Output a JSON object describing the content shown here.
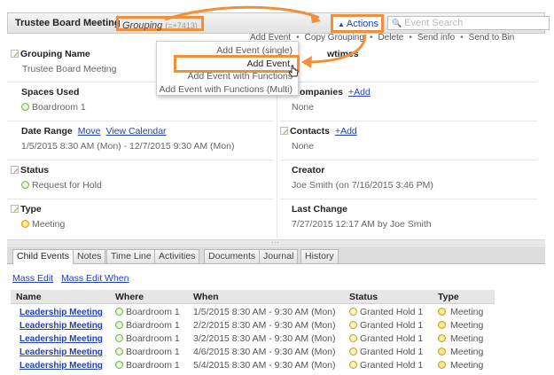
{
  "header": {
    "title": "Trustee Board Meeting",
    "grouping_label": "Grouping",
    "grouping_id": "(=+7413)",
    "actions_label": "Actions",
    "search_placeholder": "Event Search"
  },
  "action_links": [
    "Add Event",
    "Copy Grouping",
    "Delete",
    "Send info",
    "Send to Bin"
  ],
  "dropdown": {
    "items": [
      "Add Event (single)",
      "Add Event",
      "Add Event with Functions",
      "Add Event with Functions (Multi)"
    ]
  },
  "fields": {
    "grouping_name": {
      "label": "Grouping Name",
      "value": "Trustee Board Meeting"
    },
    "showtimes": {
      "label": "wtimes"
    },
    "spaces_used": {
      "label": "Spaces Used",
      "value": "Boardroom 1"
    },
    "companies": {
      "label": "ompanies",
      "add": "+Add",
      "value": "None"
    },
    "date_range": {
      "label": "Date Range",
      "move": "Move",
      "view_calendar": "View Calendar",
      "value": "1/5/2015 8:30 AM (Mon) - 12/7/2015 9:30 AM (Mon)"
    },
    "contacts": {
      "label": "Contacts",
      "add": "+Add",
      "value": "None"
    },
    "status": {
      "label": "Status",
      "value": "Request for Hold"
    },
    "creator": {
      "label": "Creator",
      "value": "Joe Smith (on 7/16/2015 3:46 PM)"
    },
    "type": {
      "label": "Type",
      "value": "Meeting"
    },
    "last_change": {
      "label": "Last Change",
      "value": "7/27/2015 12:17 AM by Joe Smith"
    }
  },
  "splitter": "...",
  "tabs": [
    "Child Events",
    "Notes",
    "Time Line",
    "Activities",
    "Documents",
    "Journal",
    "History"
  ],
  "mass": {
    "mass_edit": "Mass Edit",
    "mass_edit_when": "Mass Edit When"
  },
  "table": {
    "columns": [
      "Name",
      "Where",
      "When",
      "Status",
      "Type"
    ],
    "rows": [
      {
        "name": "Leadership Meeting",
        "where": "Boardroom 1",
        "when": "1/5/2015 8:30 AM - 9:30 AM (Mon)",
        "status": "Granted Hold 1",
        "type": "Meeting"
      },
      {
        "name": "Leadership Meeting",
        "where": "Boardroom 1",
        "when": "2/2/2015 8:30 AM - 9:30 AM (Mon)",
        "status": "Granted Hold 1",
        "type": "Meeting"
      },
      {
        "name": "Leadership Meeting",
        "where": "Boardroom 1",
        "when": "3/2/2015 8:30 AM - 9:30 AM (Mon)",
        "status": "Granted Hold 1",
        "type": "Meeting"
      },
      {
        "name": "Leadership Meeting",
        "where": "Boardroom 1",
        "when": "4/6/2015 8:30 AM - 9:30 AM (Mon)",
        "status": "Granted Hold 1",
        "type": "Meeting"
      },
      {
        "name": "Leadership Meeting",
        "where": "Boardroom 1",
        "when": "5/4/2015 8:30 AM - 9:30 AM (Mon)",
        "status": "Granted Hold 1",
        "type": "Meeting"
      }
    ]
  },
  "colors": {
    "annotation": "#f0903a",
    "link": "#1f3fbf",
    "header_bg": "#e2e2e2",
    "status_green": "#78b04a",
    "status_yellow": "#f2cf4a"
  }
}
